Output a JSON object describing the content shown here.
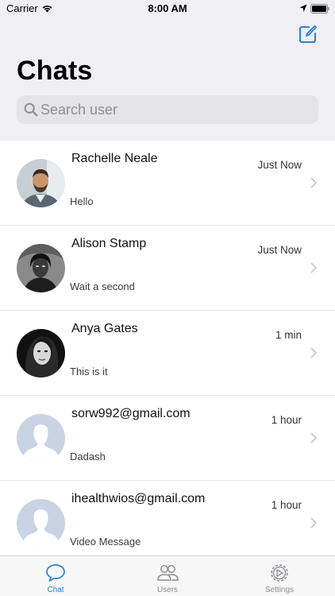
{
  "status_bar": {
    "carrier": "Carrier",
    "time": "8:00 AM"
  },
  "header": {
    "title": "Chats",
    "compose_icon": "compose-icon",
    "search": {
      "placeholder": "Search user",
      "value": ""
    }
  },
  "chats": [
    {
      "name": "Rachelle Neale",
      "preview": "Hello",
      "time": "Just Now",
      "avatar": "photo"
    },
    {
      "name": "Alison Stamp",
      "preview": "Wait a second",
      "time": "Just Now",
      "avatar": "photo"
    },
    {
      "name": "Anya Gates",
      "preview": "This is it",
      "time": "1 min",
      "avatar": "photo"
    },
    {
      "name": "sorw992@gmail.com",
      "preview": "Dadash",
      "time": "1 hour",
      "avatar": "placeholder"
    },
    {
      "name": "ihealthwios@gmail.com",
      "preview": "Video Message",
      "time": "1 hour",
      "avatar": "placeholder"
    }
  ],
  "tabs": [
    {
      "label": "Chat",
      "icon": "chat-bubble-icon",
      "active": true
    },
    {
      "label": "Users",
      "icon": "users-icon",
      "active": false
    },
    {
      "label": "Settings",
      "icon": "settings-gear-icon",
      "active": false
    }
  ],
  "colors": {
    "accent": "#2f7fd4",
    "inactive": "#8e8e93",
    "header_bg": "#efeff4",
    "placeholder_avatar": "#c9d3e4"
  }
}
